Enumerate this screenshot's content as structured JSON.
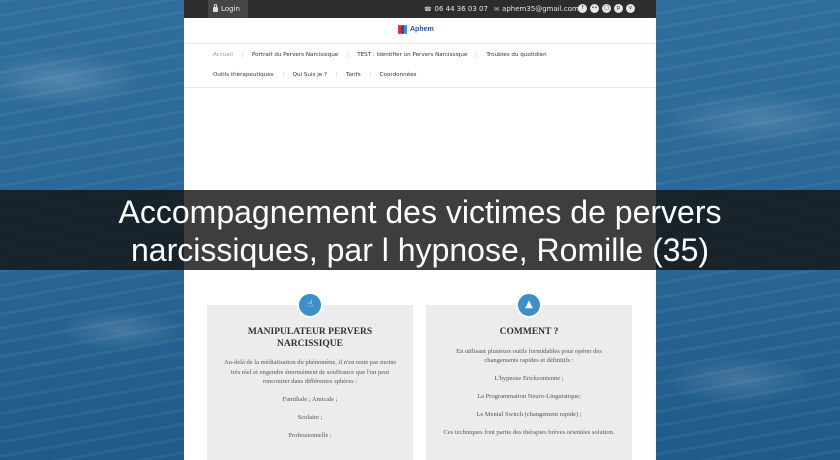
{
  "topbar": {
    "login_label": "Login",
    "phone": "06 44 36 03 07",
    "email": "aphem35@gmail.com",
    "social_icons": [
      "facebook-icon",
      "flickr-icon",
      "instagram-icon",
      "pinterest-icon",
      "vimeo-icon"
    ]
  },
  "logo": {
    "text": "Aphem",
    "colors": [
      "#e0312e",
      "#2b4ea3",
      "#3d8fc8"
    ]
  },
  "nav": {
    "row1": [
      "Accueil",
      "Portrait du Pervers Narcissique",
      "TEST : Identifier un Pervers Narcissique",
      "Troubles du quotidien"
    ],
    "row2": [
      "Outils thérapeutiques",
      "Qui Suis je ?",
      "Tarifs",
      "Coordonnées"
    ],
    "active": "Accueil"
  },
  "banner": {
    "line1": "Accompagnement des victimes de pervers",
    "line2": "narcissiques, par l hypnose, Romille (35)"
  },
  "cards": [
    {
      "icon": "thumbs-up-icon",
      "title": "MANIPULATEUR PERVERS NARCISSIQUE",
      "paragraphs": [
        "Au-delà de la médiatisation du phénomène, il n'en reste pas moins très réel et engendre énormément de souffrance que l'on peut rencontrer dans différentes sphères :",
        "Familiale ; Amicale ;",
        "Scolaire ;",
        "Professionnelle ;"
      ]
    },
    {
      "icon": "flask-icon",
      "title": "COMMENT ?",
      "paragraphs": [
        "En utilisant plusieurs outils formidables pour opérer des changements rapides et définitifs :",
        "L'hypnose Ericksonienne ;",
        "La Programmation Neuro-Linguistique;",
        "Le Mental Switch (changement rapide) ;",
        "Ces techniques font partie des thérapies brèves orientées solution."
      ]
    }
  ],
  "colors": {
    "accent": "#3d8fc8",
    "topbar": "#2d2d2d",
    "card_bg": "#ececec",
    "banner_bg": "#141414"
  }
}
